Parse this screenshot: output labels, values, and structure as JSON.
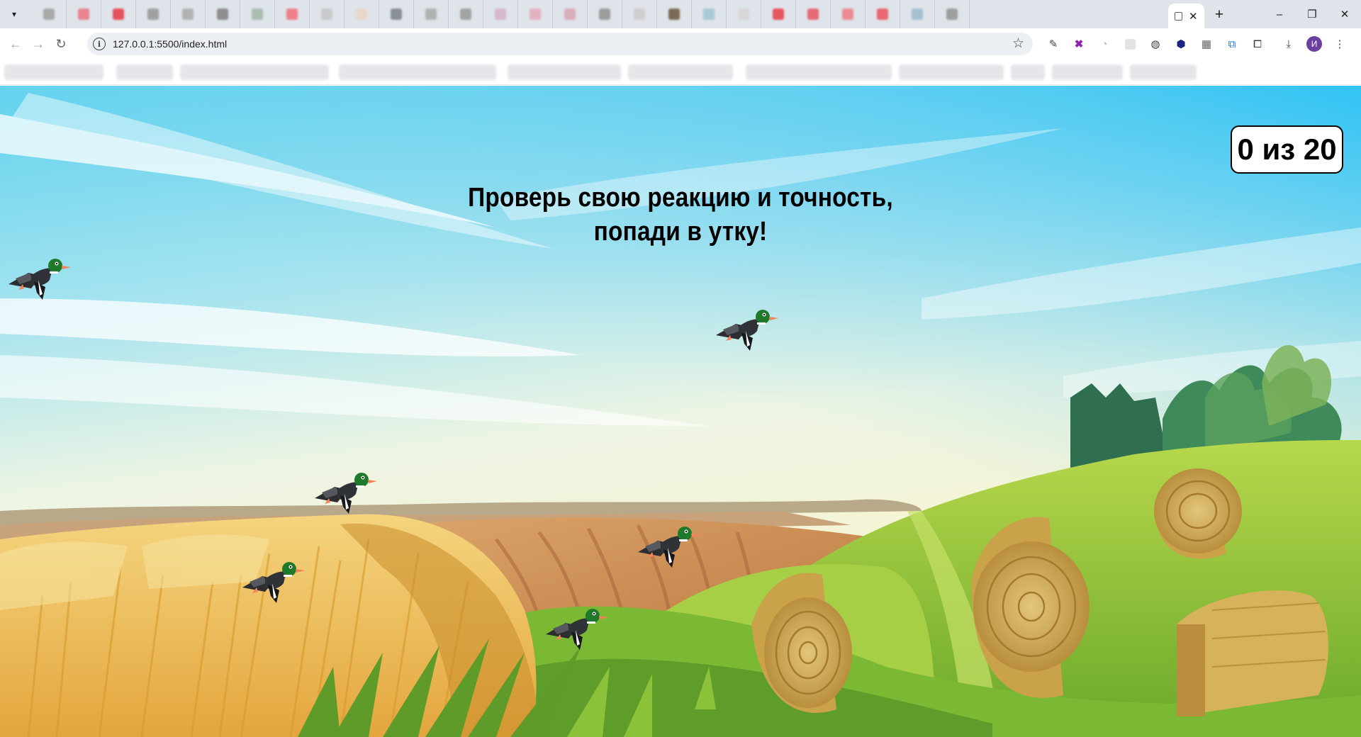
{
  "browser": {
    "url": "127.0.0.1:5500/index.html",
    "avatar_letter": "И",
    "tab_close_glyph": "✕",
    "new_tab_glyph": "+",
    "window_controls": {
      "minimize": "–",
      "restore": "❐",
      "close": "✕"
    }
  },
  "game": {
    "headline_line1": "Проверь свою реакцию и точность,",
    "headline_line2": "попади в утку!",
    "score": "0 из 20",
    "colors": {
      "sky_top": "#3fc7f2",
      "sky_bottom": "#f6f1c9",
      "wheat": "#e8b84a",
      "grass": "#8fc33a",
      "hay": "#d9b45b",
      "duck_head": "#1e7a2a",
      "duck_body": "#2f3236",
      "duck_beak": "#f4825a"
    },
    "duck_count": 6
  }
}
